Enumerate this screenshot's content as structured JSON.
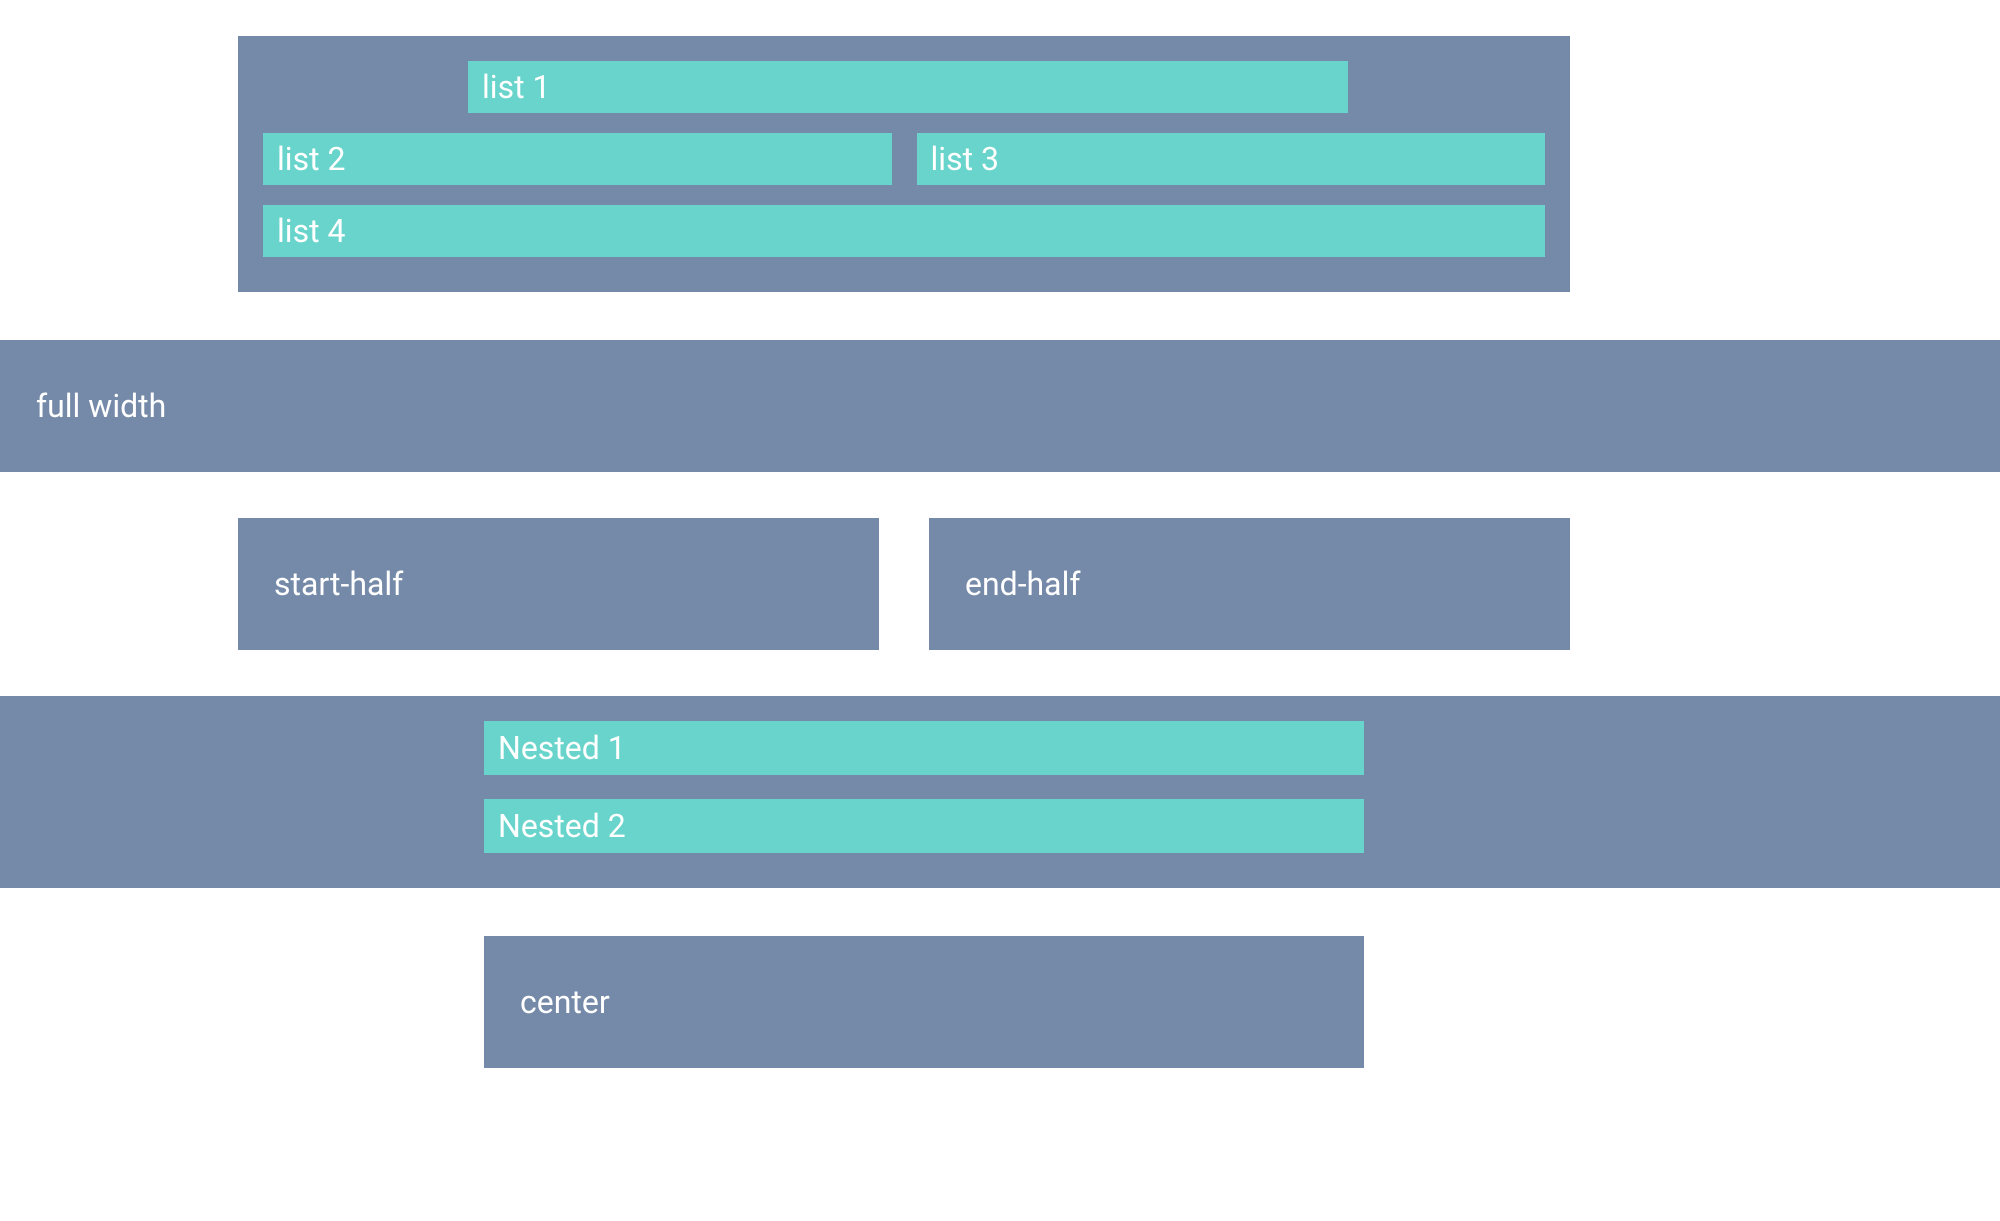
{
  "colors": {
    "container": "#758aa8",
    "item": "#68d4cb",
    "text": "#ffffff"
  },
  "top": {
    "list1": "list 1",
    "list2": "list 2",
    "list3": "list 3",
    "list4": "list 4"
  },
  "full_width": {
    "label": "full width"
  },
  "halves": {
    "start": "start-half",
    "end": "end-half"
  },
  "nested": {
    "item1": "Nested 1",
    "item2": "Nested 2"
  },
  "center": {
    "label": "center"
  }
}
